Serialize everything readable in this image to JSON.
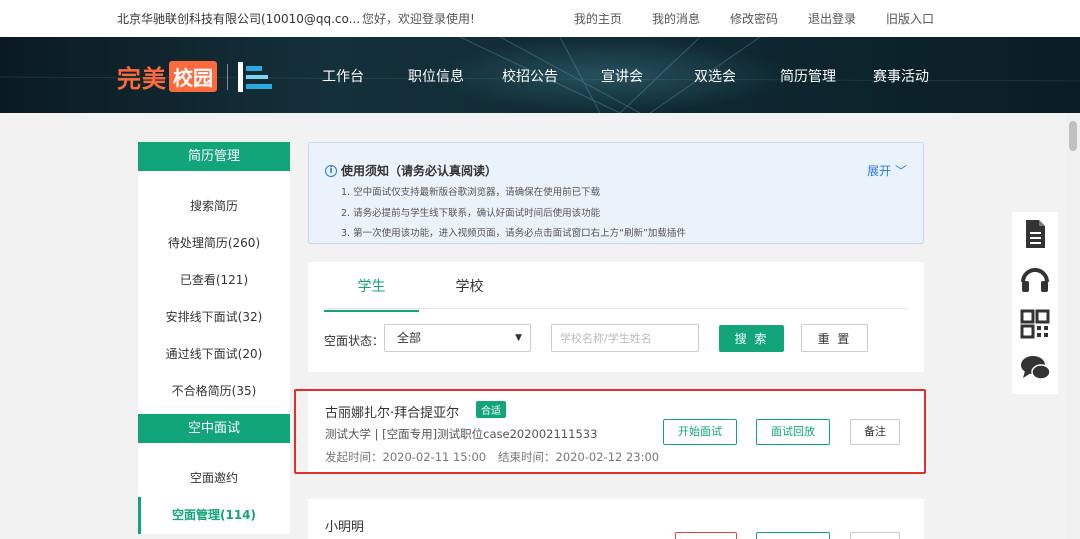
{
  "topbar": {
    "company": "北京华驰联创科技有限公司(10010@qq.co...",
    "welcome": "您好，欢迎登录使用!",
    "links": [
      "我的主页",
      "我的消息",
      "修改密码",
      "退出登录",
      "旧版入口"
    ]
  },
  "header": {
    "logo_word1": "完美",
    "logo_word2": "校园",
    "nav": [
      "工作台",
      "职位信息",
      "校招公告",
      "宣讲会",
      "双选会",
      "简历管理",
      "赛事活动"
    ]
  },
  "sidebar": {
    "group1": {
      "title": "简历管理",
      "items": [
        "搜索简历",
        "待处理简历(260)",
        "已查看(121)",
        "安排线下面试(32)",
        "通过线下面试(20)",
        "不合格简历(35)"
      ]
    },
    "group2": {
      "title": "空中面试",
      "items": [
        "空面邀约",
        "空面管理(114)"
      ]
    }
  },
  "notice": {
    "title": "使用须知（请务必认真阅读）",
    "expand_label": "展开",
    "lines": [
      "1. 空中面试仅支持最新版谷歌浏览器，请确保在使用前已下载",
      "2. 请务必提前与学生线下联系，确认好面试时间后使用该功能",
      "3. 第一次使用该功能，进入视频页面，请务必点击面试窗口右上方“刷新”加载插件"
    ]
  },
  "tabs": [
    "学生",
    "学校"
  ],
  "filter": {
    "status_label": "空面状态：",
    "status_value": "全部",
    "search_placeholder": "学校名称/学生姓名",
    "search_button": "搜 索",
    "reset_button": "重 置"
  },
  "records": [
    {
      "name": "古丽娜扎尔·拜合提亚尔",
      "badge": "合适",
      "info": "测试大学 | [空面专用]测试职位case202002111533",
      "start_label": "发起时间：2020-02-11 15:00",
      "end_label": "结束时间：2020-02-12 23:00",
      "buttons": [
        "开始面试",
        "面试回放",
        "备注"
      ]
    },
    {
      "name": "小明明"
    }
  ],
  "colors": {
    "accent": "#12a57a",
    "highlight_border": "#e0302a",
    "logo": "#ff6a3d"
  }
}
